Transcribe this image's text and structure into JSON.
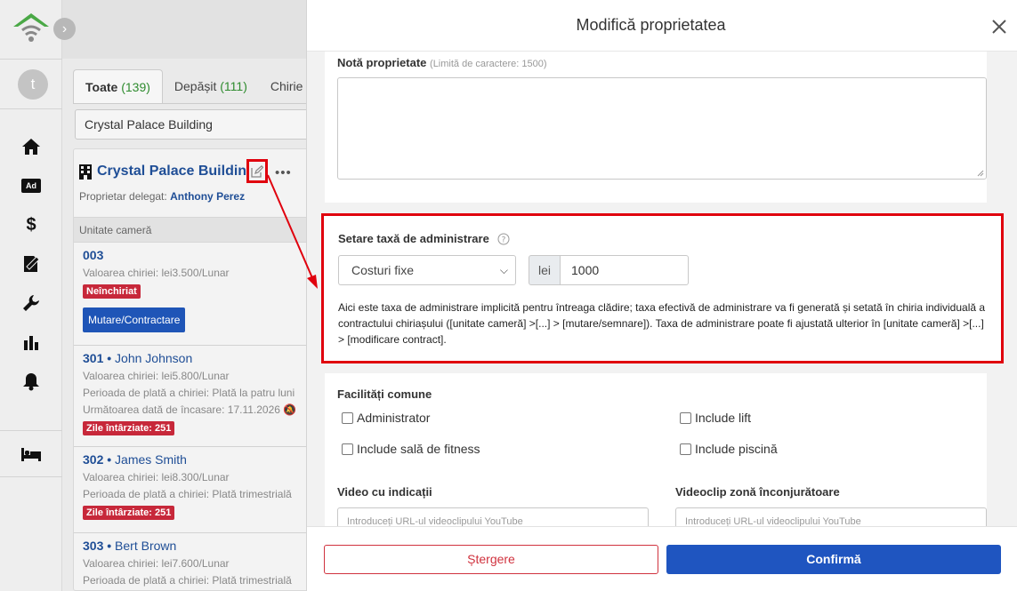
{
  "sidebar": {
    "avatar_letter": "t",
    "icons": [
      "home-icon",
      "ad-icon",
      "dollar-icon",
      "contract-icon",
      "wrench-icon",
      "chart-icon",
      "bell-icon",
      "bed-icon"
    ],
    "ad_label": "Ad"
  },
  "tabs": [
    {
      "label": "Toate",
      "count": "(139)"
    },
    {
      "label": "Depășit",
      "count": "(111)"
    },
    {
      "label": "Chirie",
      "count": ""
    }
  ],
  "property_select": "Crystal Palace Building",
  "building": {
    "name": "Crystal Palace Building",
    "owner_label": "Proprietar delegat:",
    "owner_name": "Anthony Perez",
    "unit_header": "Unitate cameră"
  },
  "units": [
    {
      "number": "003",
      "tenant": "",
      "rent": "Valoarea chiriei: lei3.500/Lunar",
      "badge": "Neînchiriat",
      "button": "Mutare/Contractare"
    },
    {
      "number": "301",
      "tenant": "John Johnson",
      "rent": "Valoarea chiriei: lei5.800/Lunar",
      "period": "Perioada de plată a chiriei: Plată la patru luni",
      "next_label": "Următoarea dată de încasare:",
      "next_date": "17.11.2026",
      "badge": "Zile întârziate: 251"
    },
    {
      "number": "302",
      "tenant": "James Smith",
      "rent": "Valoarea chiriei: lei8.300/Lunar",
      "period": "Perioada de plată a chiriei: Plată trimestrială",
      "badge": "Zile întârziate: 251"
    },
    {
      "number": "303",
      "tenant": "Bert Brown",
      "rent": "Valoarea chiriei: lei7.600/Lunar",
      "period": "Perioada de plată a chiriei: Plată trimestrială"
    }
  ],
  "modal": {
    "title": "Modifică proprietatea",
    "note_label": "Notă proprietate",
    "note_hint": "(Limită de caractere: 1500)",
    "note_value": "",
    "fee_label": "Setare taxă de administrare",
    "fee_type": "Costuri fixe",
    "fee_currency": "lei",
    "fee_value": "1000",
    "fee_description": "Aici este taxa de administrare implicită pentru întreaga clădire; taxa efectivă de administrare va fi generată și setată în chiria individuală a contractului chiriașului ([unitate cameră] >[...] > [mutare/semnare]). Taxa de administrare poate fi ajustată ulterior în [unitate cameră] >[...] > [modificare contract].",
    "facilities_label": "Facilități comune",
    "facilities": [
      "Administrator",
      "Include lift",
      "Include sală de fitness",
      "Include piscină"
    ],
    "video_label": "Video cu indicații",
    "video_placeholder": "Introduceți URL-ul videoclipului YouTube",
    "area_video_label": "Videoclip zonă înconjurătoare",
    "area_video_placeholder": "Introduceți URL-ul videoclipului YouTube",
    "delete_label": "Ștergere",
    "confirm_label": "Confirmă"
  },
  "colors": {
    "accent": "#1f55c0",
    "highlight": "#e0000d",
    "danger": "#d0323e",
    "success": "#2e8b2e"
  }
}
